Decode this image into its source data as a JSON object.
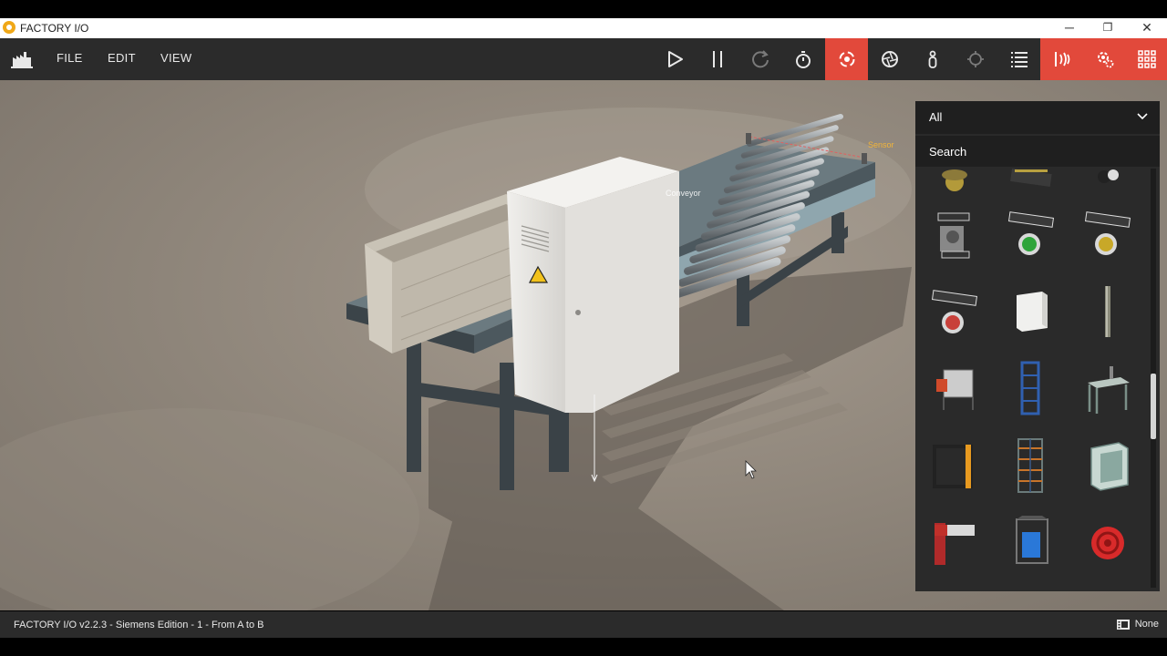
{
  "window": {
    "title": "FACTORY I/O",
    "minimize_glyph": "─",
    "maximize_glyph": "❐",
    "close_glyph": "✕"
  },
  "menu": {
    "items": [
      "FILE",
      "EDIT",
      "VIEW"
    ]
  },
  "toolbar": {
    "buttons": [
      {
        "name": "play-icon",
        "active": false
      },
      {
        "name": "pause-icon",
        "active": false
      },
      {
        "name": "reset-icon",
        "active": false
      },
      {
        "name": "stopwatch-icon",
        "active": false
      },
      {
        "name": "camera-orbit-icon",
        "active": true
      },
      {
        "name": "aperture-icon",
        "active": false
      },
      {
        "name": "first-person-icon",
        "active": false
      },
      {
        "name": "crosshair-icon",
        "active": false
      },
      {
        "name": "list-icon",
        "active": false
      },
      {
        "name": "drivers-icon",
        "active": true
      },
      {
        "name": "settings-icon",
        "active": true
      },
      {
        "name": "grid-icon",
        "active": true
      }
    ],
    "accent_color": "#e2493b"
  },
  "scene": {
    "labels": [
      "Sensor",
      "Conveyor"
    ]
  },
  "catalog": {
    "filter_value": "All",
    "search_placeholder": "Search",
    "items": [
      {
        "name": "emergency-stop-item"
      },
      {
        "name": "panel-strip-item"
      },
      {
        "name": "stack-light-item"
      },
      {
        "name": "selector-switch-item"
      },
      {
        "name": "start-button-item"
      },
      {
        "name": "reset-button-item"
      },
      {
        "name": "stop-button-item"
      },
      {
        "name": "electrical-box-item"
      },
      {
        "name": "post-item"
      },
      {
        "name": "robot-cell-item"
      },
      {
        "name": "elevator-item"
      },
      {
        "name": "workstation-item"
      },
      {
        "name": "door-frame-item"
      },
      {
        "name": "rack-item"
      },
      {
        "name": "machining-center-item"
      },
      {
        "name": "pick-place-item"
      },
      {
        "name": "tank-item"
      },
      {
        "name": "warning-siren-item"
      }
    ],
    "scroll_fraction": 0.58
  },
  "status": {
    "text": "FACTORY I/O v2.2.3 - Siemens Edition - 1 - From A to B",
    "right_text": "None"
  }
}
